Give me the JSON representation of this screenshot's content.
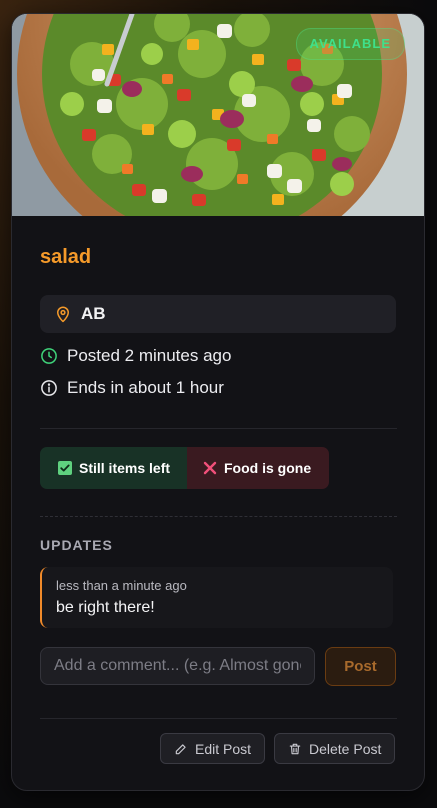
{
  "listing": {
    "status_badge": "AVAILABLE",
    "title": "salad",
    "location": "AB",
    "posted": "Posted 2 minutes ago",
    "ends": "Ends in about 1 hour"
  },
  "status_toggle": {
    "still_items_left": "Still items left",
    "food_is_gone": "Food is gone"
  },
  "updates": {
    "heading": "UPDATES",
    "items": [
      {
        "time": "less than a minute ago",
        "message": "be right there!"
      }
    ]
  },
  "comment": {
    "placeholder": "Add a comment... (e.g. Almost gone!)",
    "value": "",
    "post_label": "Post"
  },
  "actions": {
    "edit_label": "Edit Post",
    "delete_label": "Delete Post"
  },
  "colors": {
    "accent_orange": "#f59a2a",
    "available_green": "#3fe08a",
    "card_bg": "#121216"
  },
  "icons": [
    "map-pin-icon",
    "clock-icon",
    "info-icon",
    "check-icon",
    "x-icon",
    "pencil-icon",
    "trash-icon"
  ]
}
